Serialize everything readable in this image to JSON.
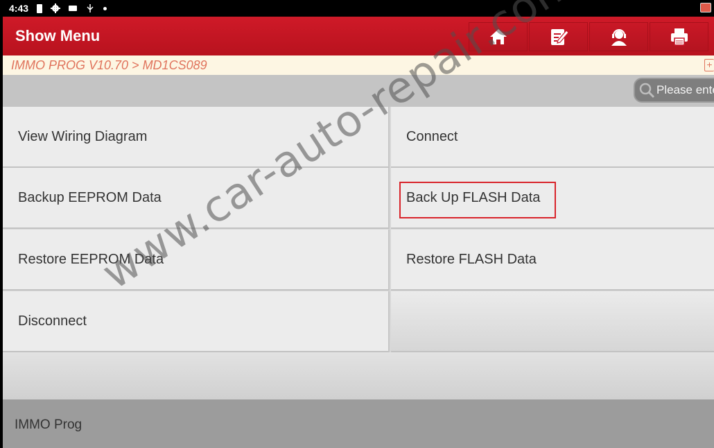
{
  "status_bar": {
    "time": "4:43",
    "icons": [
      "battery-icon",
      "settings-icon",
      "camera-icon",
      "usb-icon",
      "notification-dot-icon"
    ],
    "right_icon": "cast-icon"
  },
  "header": {
    "title": "Show Menu",
    "buttons": [
      {
        "name": "home",
        "icon": "home-icon"
      },
      {
        "name": "report",
        "icon": "edit-report-icon"
      },
      {
        "name": "support",
        "icon": "support-agent-icon"
      },
      {
        "name": "print",
        "icon": "printer-icon"
      }
    ],
    "accent_color": "#c8172a"
  },
  "breadcrumb": {
    "text": "IMMO PROG V10.70 > MD1CS089",
    "icon": "add-bookmark-icon",
    "color": "#e0735c"
  },
  "search": {
    "placeholder": "Please enter"
  },
  "menu": {
    "items": [
      {
        "label": "View Wiring Diagram"
      },
      {
        "label": "Connect"
      },
      {
        "label": "Backup EEPROM Data"
      },
      {
        "label": "Back Up FLASH Data",
        "highlighted": true
      },
      {
        "label": "Restore EEPROM Data"
      },
      {
        "label": "Restore FLASH Data"
      },
      {
        "label": "Disconnect"
      },
      {
        "label": ""
      }
    ],
    "highlight_color": "#d8232a"
  },
  "footer": {
    "label": "IMMO Prog"
  },
  "watermark": {
    "text": "www.car-auto-repair.com"
  }
}
